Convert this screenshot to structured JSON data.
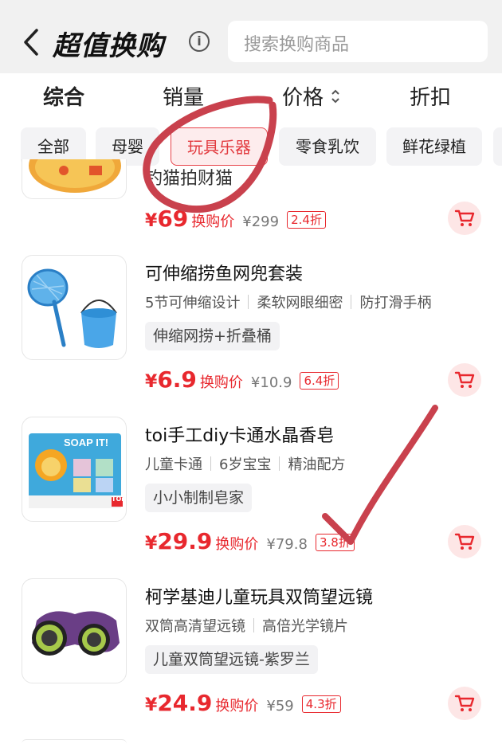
{
  "header": {
    "title": "超值换购",
    "info_glyph": "i",
    "search_placeholder": "搜索换购商品"
  },
  "sort_tabs": [
    "综合",
    "销量",
    "价格",
    "折扣"
  ],
  "chips": [
    {
      "label": "全部",
      "selected": false
    },
    {
      "label": "母婴",
      "selected": false
    },
    {
      "label": "玩具乐器",
      "selected": true
    },
    {
      "label": "零食乳饮",
      "selected": false
    },
    {
      "label": "鲜花绿植",
      "selected": false
    }
  ],
  "partial_product": {
    "name_fragment": "钓猫拍财猫",
    "price": {
      "yen": "¥",
      "value": "69",
      "label": "换购价",
      "original": "¥299",
      "discount": "2.4折"
    }
  },
  "products": [
    {
      "name": "可伸缩捞鱼网兜套装",
      "features": [
        "5节可伸缩设计",
        "柔软网眼细密",
        "防打滑手柄"
      ],
      "tag": "伸缩网捞+折叠桶",
      "price": {
        "yen": "¥",
        "value": "6.9",
        "label": "换购价",
        "original": "¥10.9",
        "discount": "6.4折"
      }
    },
    {
      "name": "toi手工diy卡通水晶香皂",
      "features": [
        "儿童卡通",
        "6岁宝宝",
        "精油配方"
      ],
      "tag": "小小制制皂家",
      "box_text": "SOAP IT!",
      "brand": "TOi",
      "price": {
        "yen": "¥",
        "value": "29.9",
        "label": "换购价",
        "original": "¥79.8",
        "discount": "3.8折"
      }
    },
    {
      "name": "柯学基迪儿童玩具双筒望远镜",
      "features": [
        "双筒高清望远镜",
        "高倍光学镜片"
      ],
      "tag": "儿童双筒望远镜-紫罗兰",
      "price": {
        "yen": "¥",
        "value": "24.9",
        "label": "换购价",
        "original": "¥59",
        "discount": "4.3折"
      }
    }
  ],
  "colors": {
    "accent": "#e8282e",
    "annotation": "#c9414d",
    "chip_selected_bg": "#fdeced",
    "cart_bg": "#fde6e6"
  },
  "icons": [
    "back-arrow-icon",
    "info-icon",
    "sort-arrows-icon",
    "cart-icon"
  ]
}
